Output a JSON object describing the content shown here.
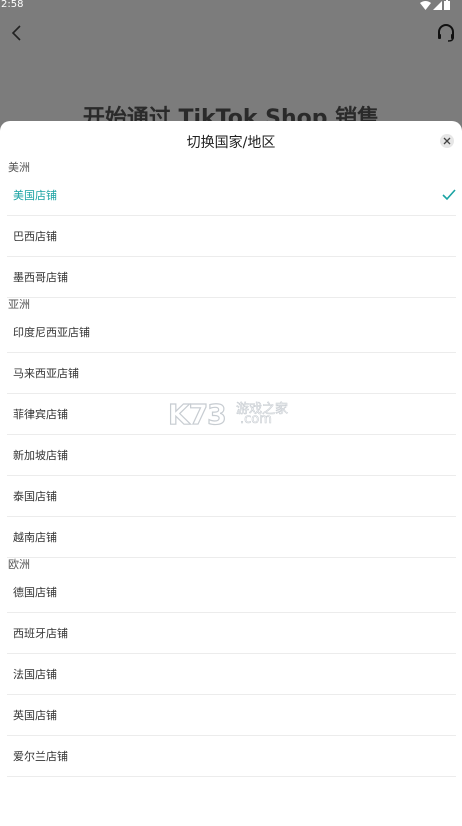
{
  "status_bar": {
    "time": "2:58"
  },
  "background_page": {
    "title": "开始通过 TikTok Shop 销售"
  },
  "sheet": {
    "title": "切换国家/地区",
    "groups": [
      {
        "label": "美洲",
        "items": [
          {
            "label": "美国店铺",
            "selected": true
          },
          {
            "label": "巴西店铺",
            "selected": false
          },
          {
            "label": "墨西哥店铺",
            "selected": false
          }
        ]
      },
      {
        "label": "亚洲",
        "items": [
          {
            "label": "印度尼西亚店铺",
            "selected": false
          },
          {
            "label": "马来西亚店铺",
            "selected": false
          },
          {
            "label": "菲律宾店铺",
            "selected": false
          },
          {
            "label": "新加坡店铺",
            "selected": false
          },
          {
            "label": "泰国店铺",
            "selected": false
          },
          {
            "label": "越南店铺",
            "selected": false
          }
        ]
      },
      {
        "label": "欧洲",
        "items": [
          {
            "label": "德国店铺",
            "selected": false
          },
          {
            "label": "西班牙店铺",
            "selected": false
          },
          {
            "label": "法国店铺",
            "selected": false
          },
          {
            "label": "英国店铺",
            "selected": false
          },
          {
            "label": "爱尔兰店铺",
            "selected": false
          }
        ]
      }
    ]
  },
  "watermark": {
    "brand": "K73",
    "text_cn": "游戏之家",
    "text_domain": ".com"
  },
  "colors": {
    "accent": "#1aa3a3",
    "overlay": "#7c7c7c"
  }
}
